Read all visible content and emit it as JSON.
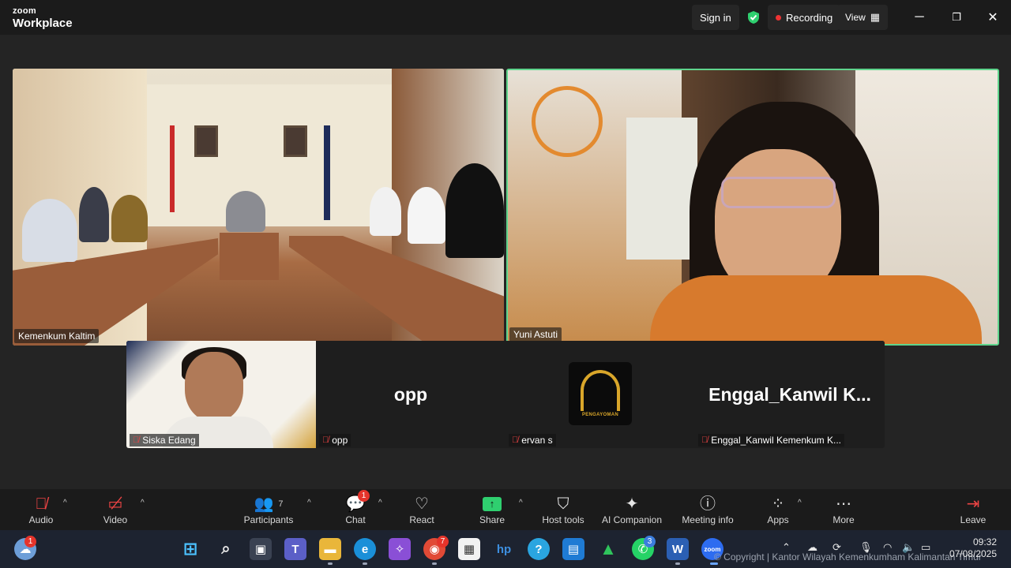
{
  "app": {
    "brand_small": "zoom",
    "brand_big": "Workplace"
  },
  "titlebar": {
    "signin_label": "Sign in",
    "recording_label": "Recording",
    "view_label": "View",
    "colors": {
      "recording_dot": "#e33333",
      "shield": "#2fcf6f"
    }
  },
  "video_tiles": [
    {
      "name": "Kemenkum Kaltim"
    },
    {
      "name": "Yuni Astuti"
    }
  ],
  "gallery": {
    "tiles": [
      {
        "label": "Siska Edang",
        "display_name": "",
        "muted": true
      },
      {
        "label": "opp",
        "display_name": "opp",
        "muted": true
      },
      {
        "label": "ervan s",
        "display_name": "",
        "muted": true,
        "avatar": "pengayoman-logo",
        "avatar_caption": "PENGAYOMAN"
      },
      {
        "label": "Enggal_Kanwil Kemenkum K...",
        "display_name": "Enggal_Kanwil K...",
        "muted": true
      }
    ]
  },
  "toolbar": {
    "audio": "Audio",
    "video": "Video",
    "participants": "Participants",
    "participants_count": "7",
    "chat": "Chat",
    "chat_badge": "1",
    "react": "React",
    "share": "Share",
    "host_tools": "Host tools",
    "ai_companion": "AI Companion",
    "meeting_info": "Meeting info",
    "apps": "Apps",
    "more": "More",
    "leave": "Leave",
    "colors": {
      "share": "#2fcf6f",
      "active_speaker_border": "#5fd58d",
      "badge": "#e5342b"
    }
  },
  "taskbar": {
    "weather_badge": "1",
    "chrome_badge": "7",
    "whatsapp_badge": "3",
    "copyright": "© Copyright | Kantor Wilayah Kemenkumham Kalimantan Timur",
    "time": "09:32",
    "date": "07/08/2025"
  }
}
